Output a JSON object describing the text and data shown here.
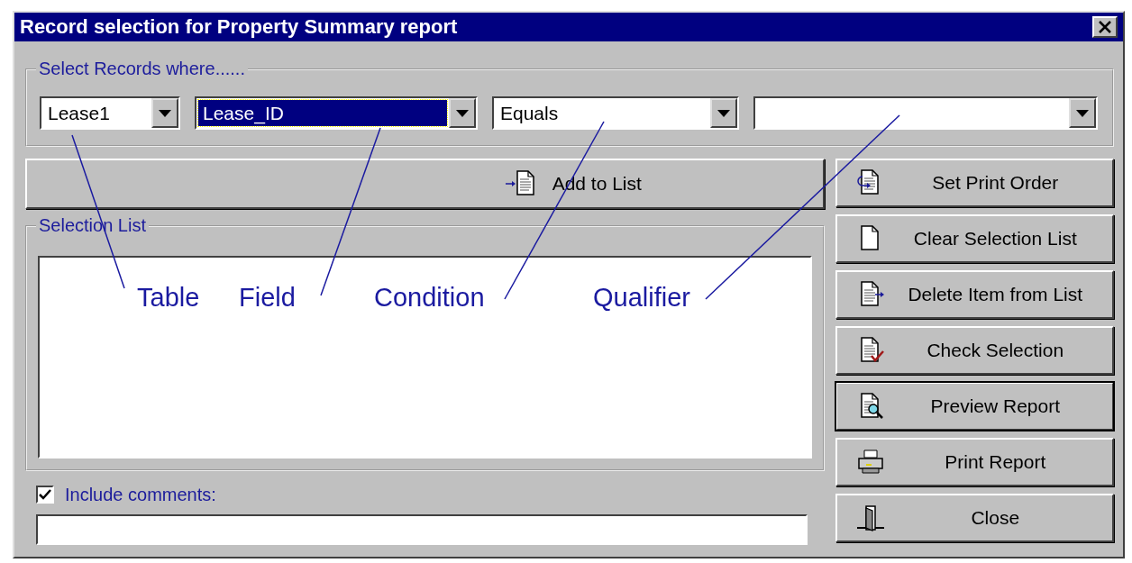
{
  "window": {
    "title": "Record selection for Property Summary report"
  },
  "criteria": {
    "label": "Select Records where......",
    "combos": [
      {
        "value": "Lease1",
        "focused": false
      },
      {
        "value": "Lease_ID",
        "focused": true
      },
      {
        "value": "Equals",
        "focused": false
      },
      {
        "focused": false
      }
    ]
  },
  "add_button": {
    "label": "Add to List"
  },
  "selection_list": {
    "label": "Selection List"
  },
  "include_comments": {
    "label": "Include comments:",
    "checked": true
  },
  "actions": [
    {
      "label": "Set Print Order",
      "kind": "order",
      "default": false
    },
    {
      "label": "Clear Selection List",
      "kind": "blank",
      "default": false
    },
    {
      "label": "Delete Item from List",
      "kind": "delete",
      "default": false
    },
    {
      "label": "Check Selection",
      "kind": "check",
      "default": false
    },
    {
      "label": "Preview Report",
      "kind": "preview",
      "default": true
    },
    {
      "label": "Print Report",
      "kind": "print",
      "default": false
    },
    {
      "label": "Close",
      "kind": "exit",
      "default": false
    }
  ],
  "annotations": [
    {
      "label": "Table"
    },
    {
      "label": "Field"
    },
    {
      "label": "Condition"
    },
    {
      "label": "Qualifier"
    }
  ]
}
